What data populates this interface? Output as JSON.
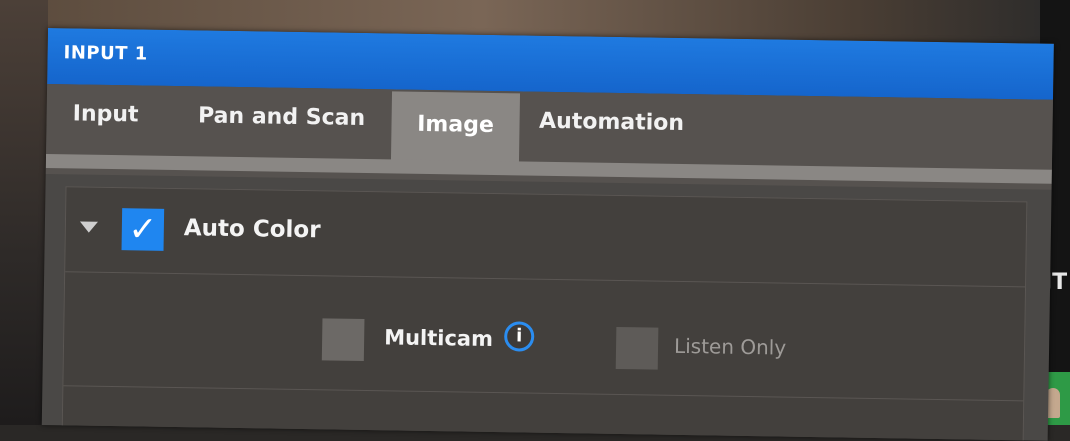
{
  "window": {
    "title": "INPUT 1"
  },
  "tabs": [
    {
      "label": "Input",
      "active": false
    },
    {
      "label": "Pan and Scan",
      "active": false
    },
    {
      "label": "Image",
      "active": true
    },
    {
      "label": "Automation",
      "active": false
    }
  ],
  "auto_color": {
    "label": "Auto Color",
    "checked": true,
    "check_glyph": "✓"
  },
  "options": {
    "multicam": {
      "label": "Multicam",
      "checked": false,
      "info_glyph": "i"
    },
    "listen_only": {
      "label": "Listen Only",
      "checked": false,
      "disabled": true
    }
  },
  "background": {
    "right_edge_text": "JT"
  },
  "colors": {
    "titlebar": "#1f7ae0",
    "active_tab": "#8a8784",
    "checkbox_checked": "#1f86f0",
    "info_ring": "#2b8df0"
  }
}
